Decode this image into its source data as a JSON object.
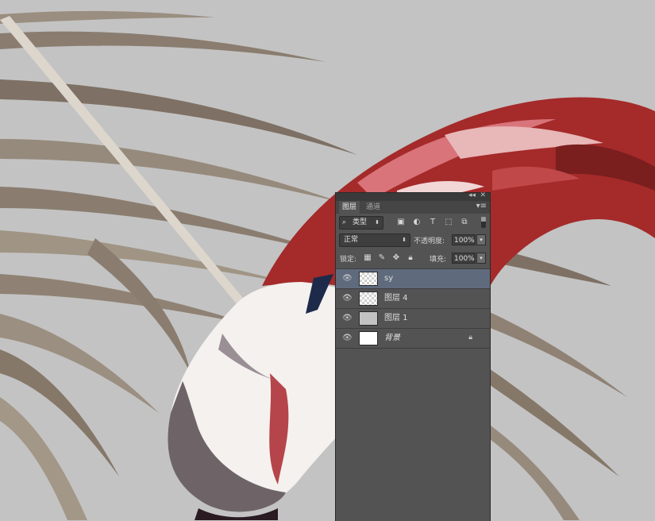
{
  "colors": {
    "canvas_bg": "#c3c3c3",
    "panel_bg": "#535353",
    "selected_row": "#5f6b7d",
    "flamingo_red": "#a52a2a",
    "leaf_taupe": "#8a7d70"
  },
  "panel": {
    "tabs": [
      {
        "label": "图层"
      },
      {
        "label": "通道"
      }
    ],
    "filter": {
      "kind_label": "类型",
      "icons": [
        "image-filter-icon",
        "adjustment-filter-icon",
        "type-filter-icon",
        "shape-filter-icon",
        "smart-object-filter-icon"
      ]
    },
    "blend_mode": "正常",
    "opacity_label": "不透明度:",
    "opacity_value": "100%",
    "lock_label": "锁定:",
    "fill_label": "填充:",
    "fill_value": "100%",
    "layers": [
      {
        "name": "sy",
        "selected": true
      },
      {
        "name": "图层 4",
        "selected": false
      },
      {
        "name": "图层 1",
        "selected": false
      },
      {
        "name": "背景",
        "selected": false,
        "locked": true
      }
    ]
  }
}
